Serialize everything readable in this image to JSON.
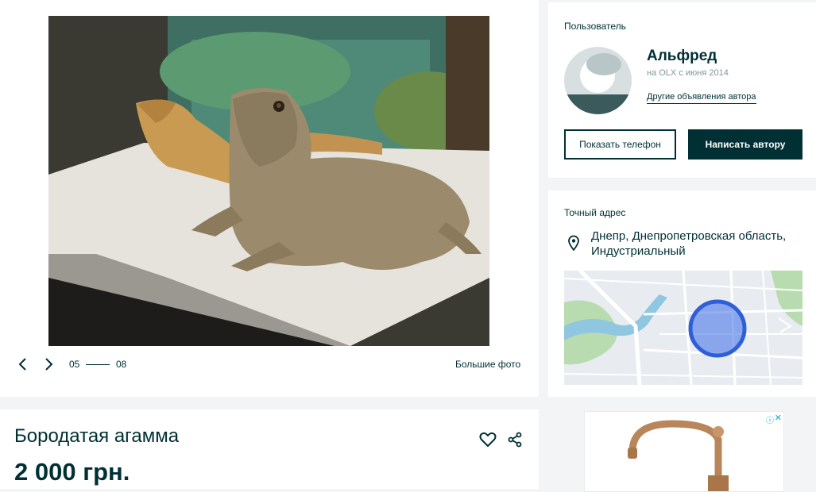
{
  "gallery": {
    "photo_index": "05",
    "photo_total": "08",
    "big_photos_label": "Большие фото",
    "prev_icon": "chevron-left-icon",
    "next_icon": "chevron-right-icon"
  },
  "listing": {
    "title": "Бородатая агамма",
    "price": "2 000 грн.",
    "favorite_icon": "heart-icon",
    "share_icon": "share-icon"
  },
  "user": {
    "section_label": "Пользователь",
    "name": "Альфред",
    "since": "на OLX с июня 2014",
    "other_ads_link": "Другие объявления автора",
    "show_phone_label": "Показать телефон",
    "write_author_label": "Написать автору"
  },
  "address": {
    "section_label": "Точный адрес",
    "text": "Днепр, Днепропетровская область, Индустриальный",
    "pin_icon": "location-pin-icon"
  },
  "colors": {
    "primary": "#002f34",
    "background": "#f2f4f5",
    "map_circle": "#3a6ee8",
    "ad_choices": "#00aecd"
  }
}
